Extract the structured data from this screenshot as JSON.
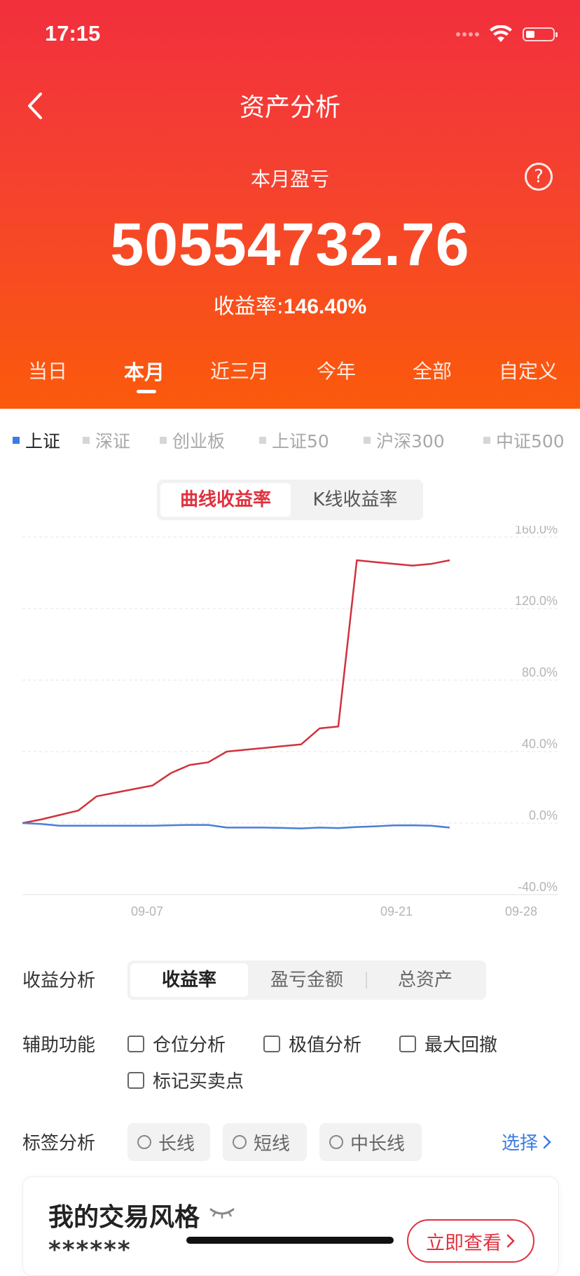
{
  "status_bar": {
    "time": "17:15"
  },
  "header": {
    "title": "资产分析",
    "pnl_label": "本月盈亏",
    "pnl_value": "50554732.76",
    "rate_label": "收益率:",
    "rate_value": "146.40%",
    "help_glyph": "?"
  },
  "period_tabs": [
    {
      "label": "当日",
      "active": false
    },
    {
      "label": "本月",
      "active": true
    },
    {
      "label": "近三月",
      "active": false
    },
    {
      "label": "今年",
      "active": false
    },
    {
      "label": "全部",
      "active": false
    },
    {
      "label": "自定义",
      "active": false
    }
  ],
  "indexes": [
    {
      "label": "上证",
      "active": true
    },
    {
      "label": "深证",
      "active": false
    },
    {
      "label": "创业板",
      "active": false
    },
    {
      "label": "上证50",
      "active": false
    },
    {
      "label": "沪深300",
      "active": false
    },
    {
      "label": "中证500",
      "active": false
    }
  ],
  "chart_mode": {
    "options": [
      "曲线收益率",
      "K线收益率"
    ],
    "active": 0
  },
  "chart_data": {
    "type": "line",
    "ylim": [
      -40,
      160
    ],
    "y_ticks": [
      "160.0%",
      "120.0%",
      "80.0%",
      "40.0%",
      "0.0%",
      "-40.0%"
    ],
    "x_ticks": [
      "09-07",
      "09-21",
      "09-28"
    ],
    "grid": true,
    "series": [
      {
        "color": "#d0333c",
        "values": [
          0,
          2,
          4.5,
          7,
          15,
          17,
          19,
          21,
          28,
          32.5,
          34,
          40,
          41,
          42,
          43,
          44,
          53,
          54,
          147,
          146,
          145,
          144,
          145,
          147
        ]
      },
      {
        "color": "#4a7fd8",
        "values": [
          0,
          -0.5,
          -1.5,
          -1.5,
          -1.5,
          -1.5,
          -1.5,
          -1.5,
          -1.2,
          -1,
          -1,
          -2.5,
          -2.5,
          -2.5,
          -2.7,
          -3,
          -2.5,
          -2.8,
          -2.2,
          -1.8,
          -1.3,
          -1.2,
          -1.5,
          -2.5
        ]
      }
    ]
  },
  "analysis": {
    "profit_label": "收益分析",
    "profit_options": [
      "收益率",
      "盈亏金额",
      "总资产"
    ],
    "profit_active": 0,
    "aux_label": "辅助功能",
    "aux_options": [
      "仓位分析",
      "极值分析",
      "最大回撤",
      "标记买卖点"
    ],
    "tag_label": "标签分析",
    "tag_options": [
      "长线",
      "短线",
      "中长线"
    ],
    "select_label": "选择"
  },
  "style_card": {
    "title": "我的交易风格",
    "stars": "******",
    "button_label": "立即查看"
  },
  "colors": {
    "accent": "#e0313f",
    "link": "#3b7be4"
  }
}
